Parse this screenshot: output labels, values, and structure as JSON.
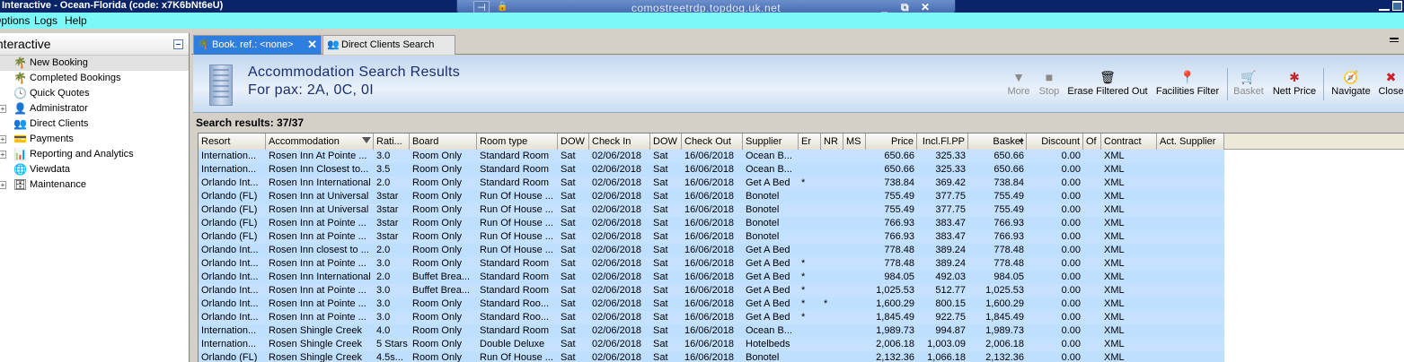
{
  "window": {
    "title": "Interactive - Ocean-Florida (code: x7K6bNt6eU)"
  },
  "rdp": {
    "host": "comostreetrdp.topdog.uk.net",
    "min_glyph": "_",
    "restore_glyph": "⧉",
    "close_glyph": "✕"
  },
  "menu": {
    "items": [
      "Options",
      "Logs",
      "Help"
    ]
  },
  "sidebar": {
    "title": "Interactive",
    "items": [
      {
        "label": "New Booking",
        "icon": "palm-tree-icon",
        "glyph": "🌴",
        "expandable": false,
        "selected": true
      },
      {
        "label": "Completed Bookings",
        "icon": "palm-tree-icon",
        "glyph": "🌴",
        "expandable": false
      },
      {
        "label": "Quick Quotes",
        "icon": "clock-icon",
        "glyph": "🕓",
        "expandable": false
      },
      {
        "label": "Administrator",
        "icon": "admin-user-icon",
        "glyph": "👤",
        "expandable": true
      },
      {
        "label": "Direct Clients",
        "icon": "clients-icon",
        "glyph": "👥",
        "expandable": false
      },
      {
        "label": "Payments",
        "icon": "payments-icon",
        "glyph": "💳",
        "expandable": true
      },
      {
        "label": "Reporting and Analytics",
        "icon": "report-icon",
        "glyph": "📊",
        "expandable": true
      },
      {
        "label": "Viewdata",
        "icon": "globe-icon",
        "glyph": "🌐",
        "expandable": false
      },
      {
        "label": "Maintenance",
        "icon": "database-icon",
        "glyph": "🗄",
        "expandable": true
      }
    ]
  },
  "tabs": [
    {
      "label": "Book. ref.: <none>",
      "active": true,
      "close_glyph": "✕"
    },
    {
      "label": "Direct Clients Search",
      "active": false
    }
  ],
  "header": {
    "title": "Accommodation Search Results",
    "subtitle": "For pax: 2A, 0C, 0I"
  },
  "toolbar": {
    "buttons": [
      {
        "label": "More",
        "icon": "down-arrow-icon",
        "glyph": "▼",
        "enabled": false
      },
      {
        "label": "Stop",
        "icon": "stop-icon",
        "glyph": "■",
        "enabled": false
      },
      {
        "label": "Erase Filtered Out",
        "icon": "erase-icon",
        "glyph": "🗑",
        "enabled": true
      },
      {
        "label": "Facilities Filter",
        "icon": "filter-pin-icon",
        "glyph": "📍",
        "enabled": true
      },
      {
        "label": "Basket",
        "icon": "basket-icon",
        "glyph": "🛒",
        "enabled": false
      },
      {
        "label": "Nett Price",
        "icon": "nett-price-icon",
        "glyph": "✱",
        "enabled": true
      },
      {
        "label": "Navigate",
        "icon": "navigate-icon",
        "glyph": "🧭",
        "enabled": true
      },
      {
        "label": "Close",
        "icon": "close-x-icon",
        "glyph": "✖",
        "enabled": true
      }
    ]
  },
  "results": {
    "summary": "Search results: 37/37"
  },
  "table": {
    "columns": [
      "Resort",
      "Accommodation",
      "Rati...",
      "Board",
      "Room type",
      "DOW",
      "Check In",
      "DOW",
      "Check Out",
      "Supplier",
      "Er",
      "NR",
      "MS",
      "Price",
      "Incl.Fl.PP",
      "Basket",
      "Discount",
      "Of",
      "Contract",
      "Act. Supplier"
    ],
    "rows": [
      [
        "Internation...",
        "Rosen Inn At Pointe ...",
        "3.0",
        "Room Only",
        "Standard Room",
        "Sat",
        "02/06/2018",
        "Sat",
        "16/06/2018",
        "Ocean B...",
        "",
        "",
        "",
        "650.66",
        "325.33",
        "650.66",
        "0.00",
        "",
        "XML",
        ""
      ],
      [
        "Internation...",
        "Rosen Inn Closest to...",
        "3.5",
        "Room Only",
        "Standard Room",
        "Sat",
        "02/06/2018",
        "Sat",
        "16/06/2018",
        "Ocean B...",
        "",
        "",
        "",
        "650.66",
        "325.33",
        "650.66",
        "0.00",
        "",
        "XML",
        ""
      ],
      [
        "Orlando Int...",
        "Rosen Inn International",
        "2.0",
        "Room Only",
        "Standard Room",
        "Sat",
        "02/06/2018",
        "Sat",
        "16/06/2018",
        "Get A Bed",
        "*",
        "",
        "",
        "738.84",
        "369.42",
        "738.84",
        "0.00",
        "",
        "XML",
        ""
      ],
      [
        "Orlando (FL)",
        "Rosen Inn at Universal",
        "3star",
        "Room Only",
        "Run Of House ...",
        "Sat",
        "02/06/2018",
        "Sat",
        "16/06/2018",
        "Bonotel",
        "",
        "",
        "",
        "755.49",
        "377.75",
        "755.49",
        "0.00",
        "",
        "XML",
        ""
      ],
      [
        "Orlando (FL)",
        "Rosen Inn at Universal",
        "3star",
        "Room Only",
        "Run Of House ...",
        "Sat",
        "02/06/2018",
        "Sat",
        "16/06/2018",
        "Bonotel",
        "",
        "",
        "",
        "755.49",
        "377.75",
        "755.49",
        "0.00",
        "",
        "XML",
        ""
      ],
      [
        "Orlando (FL)",
        "Rosen Inn at Pointe ...",
        "3star",
        "Room Only",
        "Run Of House ...",
        "Sat",
        "02/06/2018",
        "Sat",
        "16/06/2018",
        "Bonotel",
        "",
        "",
        "",
        "766.93",
        "383.47",
        "766.93",
        "0.00",
        "",
        "XML",
        ""
      ],
      [
        "Orlando (FL)",
        "Rosen Inn at Pointe ...",
        "3star",
        "Room Only",
        "Run Of House ...",
        "Sat",
        "02/06/2018",
        "Sat",
        "16/06/2018",
        "Bonotel",
        "",
        "",
        "",
        "766.93",
        "383.47",
        "766.93",
        "0.00",
        "",
        "XML",
        ""
      ],
      [
        "Orlando Int...",
        "Rosen Inn closest to ...",
        "2.0",
        "Room Only",
        "Run Of House ...",
        "Sat",
        "02/06/2018",
        "Sat",
        "16/06/2018",
        "Get A Bed",
        "",
        "",
        "",
        "778.48",
        "389.24",
        "778.48",
        "0.00",
        "",
        "XML",
        ""
      ],
      [
        "Orlando Int...",
        "Rosen Inn at Pointe ...",
        "3.0",
        "Room Only",
        "Standard Room",
        "Sat",
        "02/06/2018",
        "Sat",
        "16/06/2018",
        "Get A Bed",
        "*",
        "",
        "",
        "778.48",
        "389.24",
        "778.48",
        "0.00",
        "",
        "XML",
        ""
      ],
      [
        "Orlando Int...",
        "Rosen Inn International",
        "2.0",
        "Buffet Brea...",
        "Standard Room",
        "Sat",
        "02/06/2018",
        "Sat",
        "16/06/2018",
        "Get A Bed",
        "*",
        "",
        "",
        "984.05",
        "492.03",
        "984.05",
        "0.00",
        "",
        "XML",
        ""
      ],
      [
        "Orlando Int...",
        "Rosen Inn at Pointe ...",
        "3.0",
        "Buffet Brea...",
        "Standard Room",
        "Sat",
        "02/06/2018",
        "Sat",
        "16/06/2018",
        "Get A Bed",
        "*",
        "",
        "",
        "1,025.53",
        "512.77",
        "1,025.53",
        "0.00",
        "",
        "XML",
        ""
      ],
      [
        "Orlando Int...",
        "Rosen Inn at Pointe ...",
        "3.0",
        "Room Only",
        "Standard Roo...",
        "Sat",
        "02/06/2018",
        "Sat",
        "16/06/2018",
        "Get A Bed",
        "*",
        "*",
        "",
        "1,600.29",
        "800.15",
        "1,600.29",
        "0.00",
        "",
        "XML",
        ""
      ],
      [
        "Orlando Int...",
        "Rosen Inn at Pointe ...",
        "3.0",
        "Room Only",
        "Standard Roo...",
        "Sat",
        "02/06/2018",
        "Sat",
        "16/06/2018",
        "Get A Bed",
        "*",
        "",
        "",
        "1,845.49",
        "922.75",
        "1,845.49",
        "0.00",
        "",
        "XML",
        ""
      ],
      [
        "Internation...",
        "Rosen Shingle Creek",
        "4.0",
        "Room Only",
        "Standard Room",
        "Sat",
        "02/06/2018",
        "Sat",
        "16/06/2018",
        "Ocean B...",
        "",
        "",
        "",
        "1,989.73",
        "994.87",
        "1,989.73",
        "0.00",
        "",
        "XML",
        ""
      ],
      [
        "Internation...",
        "Rosen Shingle Creek",
        "5 Stars",
        "Room Only",
        "Double Deluxe",
        "Sat",
        "02/06/2018",
        "Sat",
        "16/06/2018",
        "Hotelbeds",
        "",
        "",
        "",
        "2,006.18",
        "1,003.09",
        "2,006.18",
        "0.00",
        "",
        "XML",
        ""
      ],
      [
        "Orlando (FL)",
        "Rosen Shingle Creek",
        "4.5s...",
        "Room Only",
        "Run Of House ...",
        "Sat",
        "02/06/2018",
        "Sat",
        "16/06/2018",
        "Bonotel",
        "",
        "",
        "",
        "2,132.36",
        "1,066.18",
        "2,132.36",
        "0.00",
        "",
        "XML",
        ""
      ]
    ]
  }
}
